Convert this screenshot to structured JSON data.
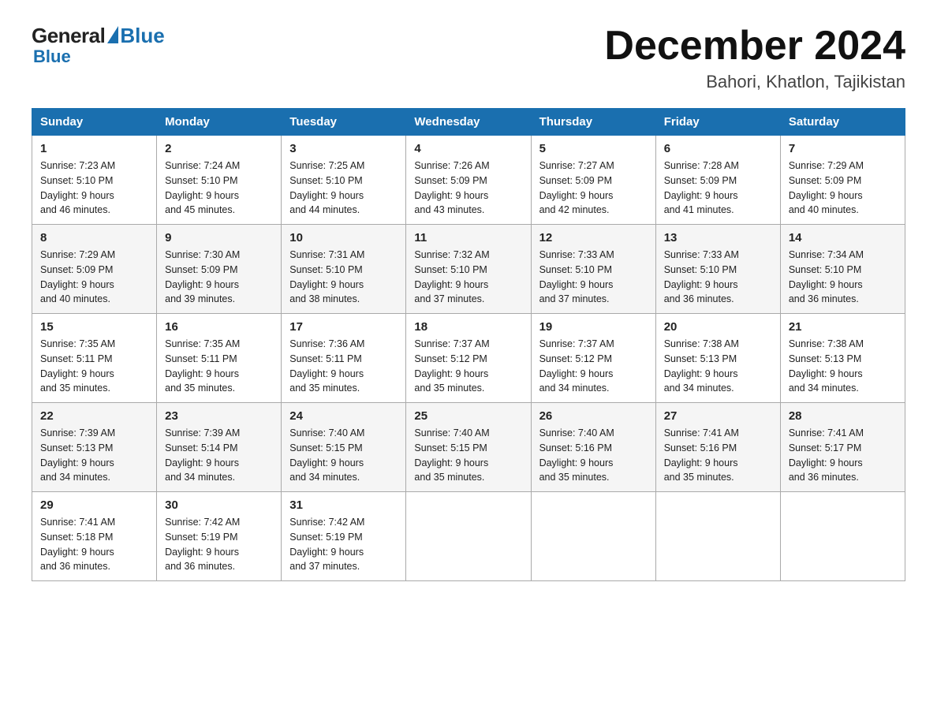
{
  "logo": {
    "general": "General",
    "blue": "Blue"
  },
  "title": "December 2024",
  "location": "Bahori, Khatlon, Tajikistan",
  "days_of_week": [
    "Sunday",
    "Monday",
    "Tuesday",
    "Wednesday",
    "Thursday",
    "Friday",
    "Saturday"
  ],
  "weeks": [
    [
      {
        "day": "1",
        "sunrise": "7:23 AM",
        "sunset": "5:10 PM",
        "daylight": "9 hours and 46 minutes."
      },
      {
        "day": "2",
        "sunrise": "7:24 AM",
        "sunset": "5:10 PM",
        "daylight": "9 hours and 45 minutes."
      },
      {
        "day": "3",
        "sunrise": "7:25 AM",
        "sunset": "5:10 PM",
        "daylight": "9 hours and 44 minutes."
      },
      {
        "day": "4",
        "sunrise": "7:26 AM",
        "sunset": "5:09 PM",
        "daylight": "9 hours and 43 minutes."
      },
      {
        "day": "5",
        "sunrise": "7:27 AM",
        "sunset": "5:09 PM",
        "daylight": "9 hours and 42 minutes."
      },
      {
        "day": "6",
        "sunrise": "7:28 AM",
        "sunset": "5:09 PM",
        "daylight": "9 hours and 41 minutes."
      },
      {
        "day": "7",
        "sunrise": "7:29 AM",
        "sunset": "5:09 PM",
        "daylight": "9 hours and 40 minutes."
      }
    ],
    [
      {
        "day": "8",
        "sunrise": "7:29 AM",
        "sunset": "5:09 PM",
        "daylight": "9 hours and 40 minutes."
      },
      {
        "day": "9",
        "sunrise": "7:30 AM",
        "sunset": "5:09 PM",
        "daylight": "9 hours and 39 minutes."
      },
      {
        "day": "10",
        "sunrise": "7:31 AM",
        "sunset": "5:10 PM",
        "daylight": "9 hours and 38 minutes."
      },
      {
        "day": "11",
        "sunrise": "7:32 AM",
        "sunset": "5:10 PM",
        "daylight": "9 hours and 37 minutes."
      },
      {
        "day": "12",
        "sunrise": "7:33 AM",
        "sunset": "5:10 PM",
        "daylight": "9 hours and 37 minutes."
      },
      {
        "day": "13",
        "sunrise": "7:33 AM",
        "sunset": "5:10 PM",
        "daylight": "9 hours and 36 minutes."
      },
      {
        "day": "14",
        "sunrise": "7:34 AM",
        "sunset": "5:10 PM",
        "daylight": "9 hours and 36 minutes."
      }
    ],
    [
      {
        "day": "15",
        "sunrise": "7:35 AM",
        "sunset": "5:11 PM",
        "daylight": "9 hours and 35 minutes."
      },
      {
        "day": "16",
        "sunrise": "7:35 AM",
        "sunset": "5:11 PM",
        "daylight": "9 hours and 35 minutes."
      },
      {
        "day": "17",
        "sunrise": "7:36 AM",
        "sunset": "5:11 PM",
        "daylight": "9 hours and 35 minutes."
      },
      {
        "day": "18",
        "sunrise": "7:37 AM",
        "sunset": "5:12 PM",
        "daylight": "9 hours and 35 minutes."
      },
      {
        "day": "19",
        "sunrise": "7:37 AM",
        "sunset": "5:12 PM",
        "daylight": "9 hours and 34 minutes."
      },
      {
        "day": "20",
        "sunrise": "7:38 AM",
        "sunset": "5:13 PM",
        "daylight": "9 hours and 34 minutes."
      },
      {
        "day": "21",
        "sunrise": "7:38 AM",
        "sunset": "5:13 PM",
        "daylight": "9 hours and 34 minutes."
      }
    ],
    [
      {
        "day": "22",
        "sunrise": "7:39 AM",
        "sunset": "5:13 PM",
        "daylight": "9 hours and 34 minutes."
      },
      {
        "day": "23",
        "sunrise": "7:39 AM",
        "sunset": "5:14 PM",
        "daylight": "9 hours and 34 minutes."
      },
      {
        "day": "24",
        "sunrise": "7:40 AM",
        "sunset": "5:15 PM",
        "daylight": "9 hours and 34 minutes."
      },
      {
        "day": "25",
        "sunrise": "7:40 AM",
        "sunset": "5:15 PM",
        "daylight": "9 hours and 35 minutes."
      },
      {
        "day": "26",
        "sunrise": "7:40 AM",
        "sunset": "5:16 PM",
        "daylight": "9 hours and 35 minutes."
      },
      {
        "day": "27",
        "sunrise": "7:41 AM",
        "sunset": "5:16 PM",
        "daylight": "9 hours and 35 minutes."
      },
      {
        "day": "28",
        "sunrise": "7:41 AM",
        "sunset": "5:17 PM",
        "daylight": "9 hours and 36 minutes."
      }
    ],
    [
      {
        "day": "29",
        "sunrise": "7:41 AM",
        "sunset": "5:18 PM",
        "daylight": "9 hours and 36 minutes."
      },
      {
        "day": "30",
        "sunrise": "7:42 AM",
        "sunset": "5:19 PM",
        "daylight": "9 hours and 36 minutes."
      },
      {
        "day": "31",
        "sunrise": "7:42 AM",
        "sunset": "5:19 PM",
        "daylight": "9 hours and 37 minutes."
      },
      null,
      null,
      null,
      null
    ]
  ],
  "labels": {
    "sunrise": "Sunrise:",
    "sunset": "Sunset:",
    "daylight": "Daylight:"
  }
}
